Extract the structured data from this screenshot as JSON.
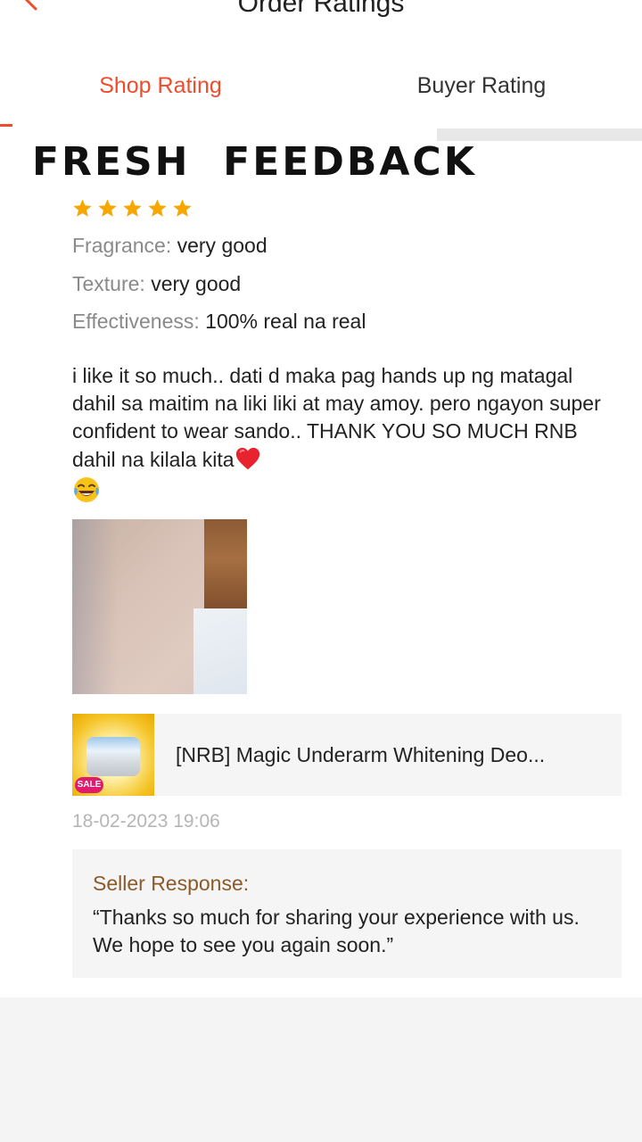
{
  "header": {
    "title": "Order Ratings"
  },
  "tabs": [
    {
      "label": "Shop Rating",
      "active": true
    },
    {
      "label": "Buyer Rating",
      "active": false
    }
  ],
  "banner": {
    "text": "FRESH  FEEDBACK"
  },
  "review": {
    "rating": 5,
    "rating_max": 5,
    "attributes": [
      {
        "key": "Fragrance:",
        "value": "very good"
      },
      {
        "key": "Texture:",
        "value": "very good"
      },
      {
        "key": "Effectiveness:",
        "value": "100% real na real"
      }
    ],
    "text": "i like it so much.. dati d maka pag hands up ng matagal dahil sa maitim na liki liki at may amoy. pero ngayon super confident to wear sando.. THANK YOU SO MUCH RNB dahil na kilala kita",
    "emojis": [
      "heart-emoji",
      "laughing-emoji"
    ],
    "timestamp": "18-02-2023 19:06"
  },
  "product": {
    "name": "[NRB] Magic Underarm Whitening Deo...",
    "badge": "SALE"
  },
  "seller_response": {
    "title": "Seller Response:",
    "text": "“Thanks so much for sharing your experience with us. We hope to see you again soon.”"
  },
  "colors": {
    "accent": "#ee4d2d",
    "star": "#f6a700",
    "seller_title": "#8b5a2b"
  }
}
